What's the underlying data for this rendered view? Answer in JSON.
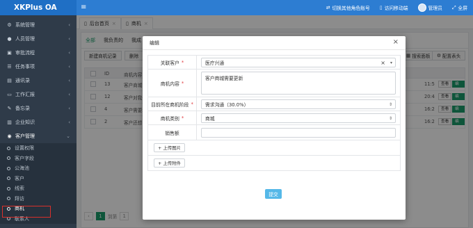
{
  "app": {
    "brand": "XKPlus OA"
  },
  "header": {
    "menu_icon": "hamburger-icon",
    "switch_role": "切换其他角色账号",
    "mobile": "访问移动端",
    "user": "管理员",
    "fullscreen": "全屏"
  },
  "sidebar": {
    "items": [
      {
        "label": "系统管理",
        "icon": "gear-icon"
      },
      {
        "label": "人员管理",
        "icon": "user-icon"
      },
      {
        "label": "审批流程",
        "icon": "flow-icon"
      },
      {
        "label": "任务事项",
        "icon": "task-icon"
      },
      {
        "label": "通讯录",
        "icon": "contacts-icon"
      },
      {
        "label": "工作汇报",
        "icon": "report-icon"
      },
      {
        "label": "备忘录",
        "icon": "memo-icon"
      },
      {
        "label": "企业知识",
        "icon": "book-icon"
      },
      {
        "label": "客户管理",
        "icon": "customer-icon"
      }
    ],
    "sub_items": [
      "设置权限",
      "客户字段",
      "公海池",
      "客户",
      "线索",
      "拜访",
      "商机",
      "联系人"
    ],
    "active_sub": "商机"
  },
  "tabs": [
    {
      "label": "后台首页"
    },
    {
      "label": "商机"
    }
  ],
  "list": {
    "subtabs": [
      "全部",
      "我负责的",
      "我成"
    ],
    "new_button": "新建商机记录",
    "delete_button": "删除",
    "search_panel": "搜索面板",
    "config_header": "配置表头",
    "columns": [
      "ID",
      "商机内容"
    ],
    "rows": [
      {
        "id": "13",
        "content": "客户商城需",
        "time": "11:5",
        "view": "查看",
        "edit": "编辑"
      },
      {
        "id": "12",
        "content": "客户对我们",
        "time": "20:4",
        "view": "查看",
        "edit": "编辑"
      },
      {
        "id": "4",
        "content": "客户需要增",
        "time": "16:2",
        "view": "查看",
        "edit": "编辑"
      },
      {
        "id": "2",
        "content": "客户还想",
        "time": "16:2",
        "view": "查看",
        "edit": "编辑"
      }
    ],
    "pager": {
      "prev": "‹",
      "current": "1",
      "goto_label": "到第",
      "page_input": "1"
    }
  },
  "modal": {
    "title": "编辑",
    "fields": {
      "customer_label": "关联客户",
      "customer_value": "医疗兴通",
      "content_label": "商机内容",
      "content_value": "客户商城需要更新",
      "stage_label": "目前所在商机阶段",
      "stage_value": "需求沟通（30.0%）",
      "type_label": "商机类别",
      "type_value": "商城",
      "amount_label": "销售额",
      "amount_value": "",
      "upload_image": "上传图片",
      "upload_file": "上传附件"
    },
    "submit": "提交",
    "required_mark": "*"
  }
}
